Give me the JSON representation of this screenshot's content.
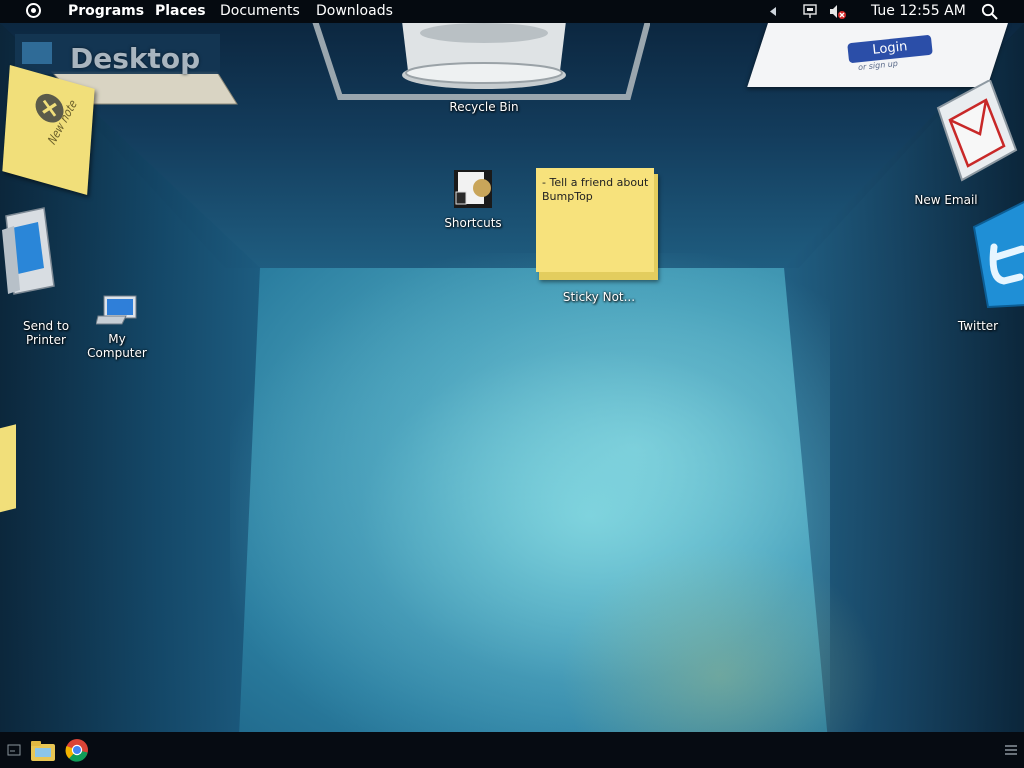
{
  "menubar": {
    "items": [
      "Programs",
      "Places",
      "Documents",
      "Downloads"
    ],
    "clock": "Tue 12:55 AM"
  },
  "desktop": {
    "wall_label": "Desktop",
    "new_note_label": "New note",
    "recycle_bin": "Recycle Bin",
    "shortcuts": "Shortcuts",
    "sticky_note_text": "- Tell a friend about BumpTop",
    "sticky_note_label": "Sticky Not...",
    "send_to_printer": "Send to\nPrinter",
    "my_computer": "My\nComputer",
    "new_email": "New Email",
    "twitter": "Twitter",
    "login_button": "Login",
    "login_signup": "or sign up"
  },
  "colors": {
    "menubar": "#050a10",
    "room_light": "#7fd0da",
    "room_dark": "#143f5a",
    "sticky": "#f7e27c"
  },
  "taskbar": {
    "icons": [
      "show-desktop-icon",
      "file-explorer-icon",
      "chrome-icon",
      "menu-icon"
    ]
  }
}
